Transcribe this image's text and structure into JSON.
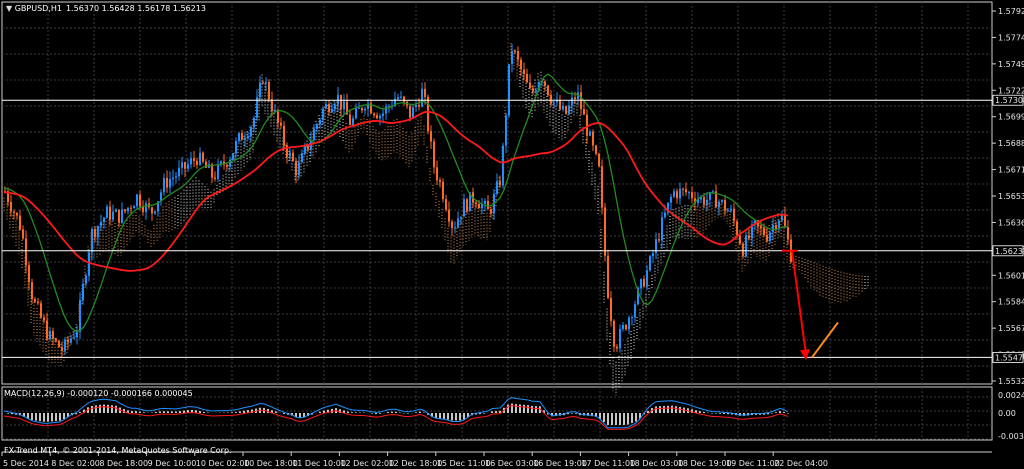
{
  "window": {
    "title": "GBPUSD,H1",
    "ohlc": "1.56370 1.56428 1.56178 1.56213",
    "copyright": "FX-Trend MT4, © 2001-2014, MetaQuotes Software Corp."
  },
  "macd": {
    "label": "MACD(12,26,9) -0.000120 -0.000166 0.000045",
    "ticks": [
      "0.002492",
      "0.00",
      "-0.003049"
    ]
  },
  "price_axis": {
    "ticks": [
      "1.57920",
      "1.57745",
      "1.57495",
      "1.57225",
      "1.56990",
      "1.56880",
      "1.56710",
      "1.56530",
      "1.56360",
      "1.56185",
      "1.56015",
      "1.55840",
      "1.55670",
      "1.55470",
      "1.55325"
    ],
    "markers": [
      {
        "value": "1.57308",
        "color": "#ffffff"
      },
      {
        "value": "1.56232",
        "color": "#ffffff"
      },
      {
        "value": "1.55470",
        "color": "#ffffff"
      }
    ]
  },
  "time_axis": [
    "5 Dec 2014",
    "8 Dec 02:00",
    "8 Dec 18:00",
    "9 Dec 10:00",
    "10 Dec 02:00",
    "10 Dec 18:00",
    "11 Dec 10:00",
    "12 Dec 02:00",
    "12 Dec 18:00",
    "15 Dec 11:00",
    "16 Dec 03:00",
    "16 Dec 19:00",
    "17 Dec 11:00",
    "18 Dec 03:00",
    "18 Dec 19:00",
    "19 Dec 11:00",
    "22 Dec 04:00"
  ],
  "colors": {
    "background": "#000000",
    "grid": "#3c3c3c",
    "bull": "#1e90ff",
    "bear": "#ff6a22",
    "ma_fast": "#228b22",
    "ma_slow": "#ff1a1a",
    "cloud_up": "#f4a460",
    "cloud_down": "#ffffff",
    "arrow_down": "#ff0000",
    "arrow_up": "#ff8c1a"
  },
  "chart_data": {
    "type": "candlestick",
    "title": "GBPUSD,H1",
    "ylim": [
      1.5528,
      1.5801
    ],
    "marker_levels": [
      1.57308,
      1.56232,
      1.5547
    ],
    "macd_range": [
      -0.0035,
      0.003
    ]
  }
}
